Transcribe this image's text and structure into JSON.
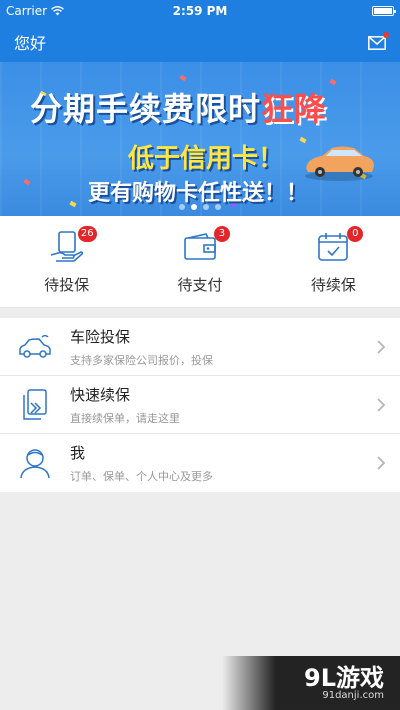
{
  "status_bar": {
    "carrier": "Carrier",
    "time": "2:59 PM"
  },
  "nav": {
    "title": "您好"
  },
  "banner": {
    "line1_a": "分期手续费限时",
    "line1_b": "狂降",
    "line2": "低于信用卡！",
    "line3": "更有购物卡任性送！！",
    "slides": 4,
    "active_slide": 1
  },
  "quick_actions": [
    {
      "label": "待投保",
      "badge": "26",
      "icon": "policy-hand-icon"
    },
    {
      "label": "待支付",
      "badge": "3",
      "icon": "wallet-icon"
    },
    {
      "label": "待续保",
      "badge": "0",
      "icon": "calendar-check-icon"
    }
  ],
  "menu": [
    {
      "title": "车险投保",
      "subtitle": "支持多家保险公司报价，投保",
      "icon": "car-insurance-icon"
    },
    {
      "title": "快速续保",
      "subtitle": "直接续保单，请走这里",
      "icon": "renew-document-icon"
    },
    {
      "title": "我",
      "subtitle": "订单、保单、个人中心及更多",
      "icon": "user-icon"
    }
  ],
  "watermark": {
    "main": "9L游戏",
    "sub": "91danji.com"
  },
  "colors": {
    "primary": "#1f7fe0",
    "badge": "#e2262a"
  }
}
